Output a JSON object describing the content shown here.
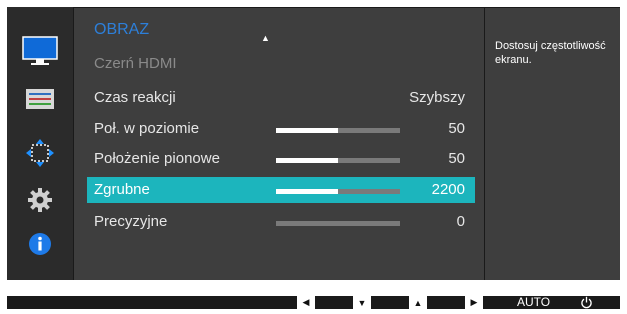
{
  "menu": {
    "title": "OBRAZ",
    "items": [
      {
        "label": "Czerń HDMI",
        "value": "",
        "state": "disabled"
      },
      {
        "label": "Czas reakcji",
        "value": "Szybszy",
        "state": "normal"
      },
      {
        "label": "Poł. w poziomie",
        "value": "50",
        "state": "normal",
        "level": 0.5
      },
      {
        "label": "Położenie pionowe",
        "value": "50",
        "state": "normal",
        "level": 0.5
      },
      {
        "label": "Zgrubne",
        "value": "2200",
        "state": "selected",
        "level": 0.5
      },
      {
        "label": "Precyzyjne",
        "value": "0",
        "state": "normal",
        "level": 0.0
      }
    ]
  },
  "help": {
    "text": "Dostosuj częstotliwość ekranu."
  },
  "bottom": {
    "auto_label": "AUTO"
  },
  "colors": {
    "accent_title": "#2d7fd9",
    "selected_row": "#1cb5bd",
    "panel": "#3e3e3e"
  },
  "icons": [
    "monitor-icon",
    "color-bars-icon",
    "move-arrows-icon",
    "gear-icon",
    "info-icon",
    "arrow-left-icon",
    "arrow-down-icon",
    "arrow-up-icon",
    "arrow-right-icon",
    "power-icon"
  ]
}
